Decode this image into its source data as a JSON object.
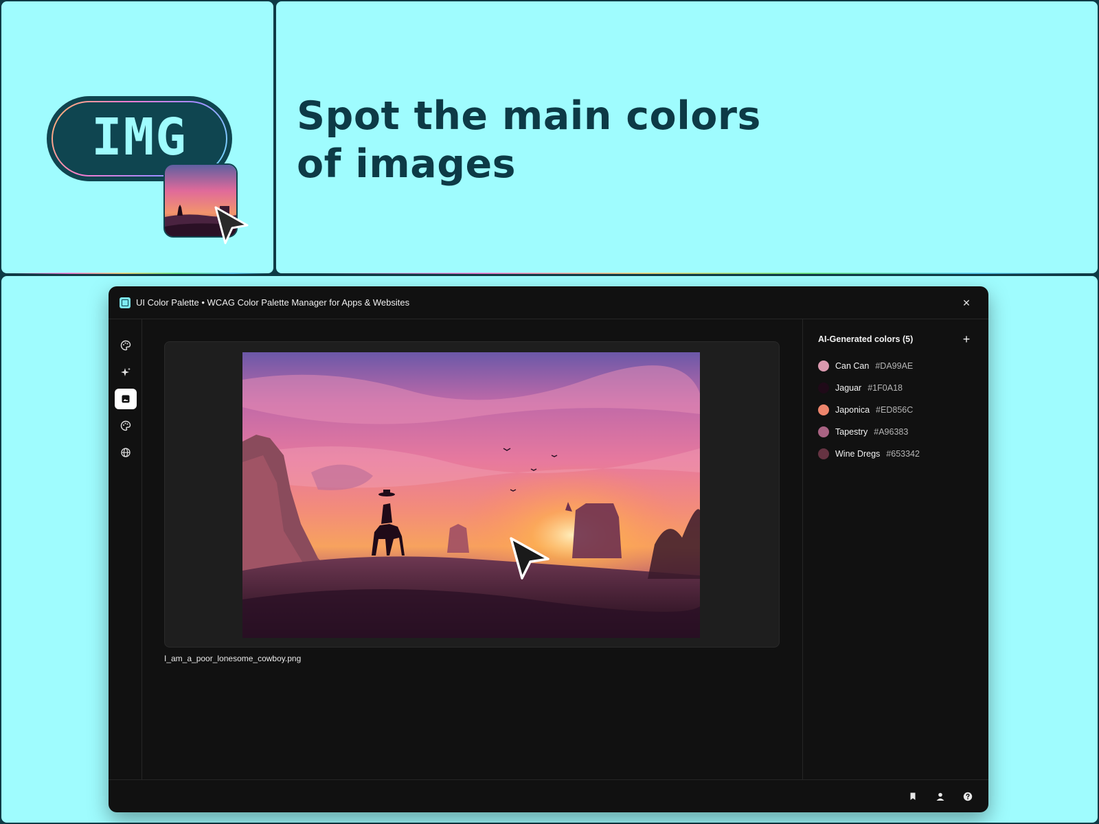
{
  "badge": {
    "text": "IMG"
  },
  "headline": {
    "line1": "Spot the main colors",
    "line2": "of images"
  },
  "window": {
    "title": "UI Color Palette • WCAG Color Palette Manager for Apps & Websites",
    "close_label": "✕"
  },
  "sidebar": {
    "items": [
      {
        "icon": "palette-icon",
        "active": false
      },
      {
        "icon": "sparkle-icon",
        "active": false
      },
      {
        "icon": "image-icon",
        "active": true
      },
      {
        "icon": "palette-icon",
        "active": false
      },
      {
        "icon": "globe-icon",
        "active": false
      }
    ]
  },
  "main": {
    "file_name": "I_am_a_poor_lonesome_cowboy.png"
  },
  "colors_panel": {
    "title": "AI-Generated colors",
    "count": "(5)",
    "add_label": "+",
    "colors": [
      {
        "name": "Can Can",
        "hex": "#DA99AE"
      },
      {
        "name": "Jaguar",
        "hex": "#1F0A18"
      },
      {
        "name": "Japonica",
        "hex": "#ED856C"
      },
      {
        "name": "Tapestry",
        "hex": "#A96383"
      },
      {
        "name": "Wine Dregs",
        "hex": "#653342"
      }
    ]
  },
  "bottombar": {
    "icons": [
      "bookmark-icon",
      "user-icon",
      "help-icon"
    ]
  },
  "theme": {
    "background": "#9ffcfe",
    "accent": "#0f4550",
    "window_bg": "#111111"
  }
}
